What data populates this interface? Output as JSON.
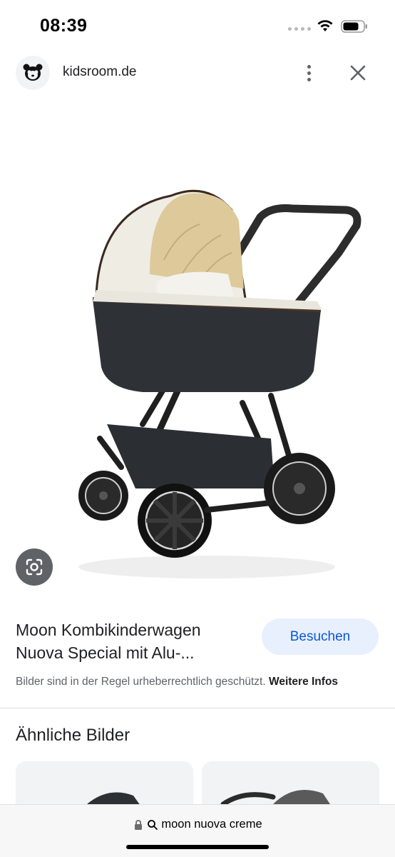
{
  "status_bar": {
    "time": "08:39",
    "icons": [
      "signal-icon",
      "wifi-icon",
      "battery-icon"
    ]
  },
  "header": {
    "site_name": "kidsroom.de",
    "avatar_icon": "panda-logo-icon",
    "more_icon": "more-vert-icon",
    "close_icon": "close-icon"
  },
  "image_viewer": {
    "image_subject": "stroller-image",
    "lens_icon": "google-lens-icon"
  },
  "result": {
    "title_line1": "Moon Kombikinderwagen",
    "title_line2": "Nuova Special mit Alu-...",
    "visit_label": "Besuchen",
    "copyright_text": "Bilder sind in der Regel urheberrechtlich geschützt.",
    "more_info_link": "Weitere Infos"
  },
  "similar": {
    "heading": "Ähnliche Bilder"
  },
  "address_bar": {
    "query": "moon nuova creme"
  },
  "colors": {
    "accent": "#0b57d0",
    "accent_bg": "#e8f0fe",
    "text_secondary": "#5f6368"
  }
}
